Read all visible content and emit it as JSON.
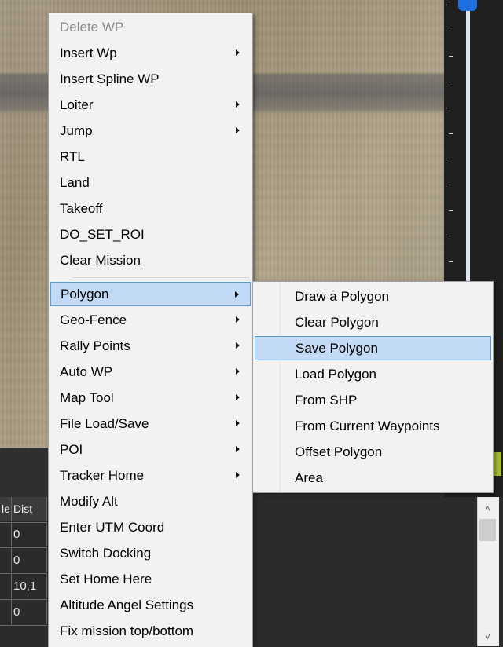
{
  "context_menu": {
    "items": [
      {
        "label": "Delete WP",
        "submenu": false,
        "disabled": true,
        "highlight": false
      },
      {
        "label": "Insert Wp",
        "submenu": true,
        "disabled": false,
        "highlight": false
      },
      {
        "label": "Insert Spline WP",
        "submenu": false,
        "disabled": false,
        "highlight": false
      },
      {
        "label": "Loiter",
        "submenu": true,
        "disabled": false,
        "highlight": false
      },
      {
        "label": "Jump",
        "submenu": true,
        "disabled": false,
        "highlight": false
      },
      {
        "label": "RTL",
        "submenu": false,
        "disabled": false,
        "highlight": false
      },
      {
        "label": "Land",
        "submenu": false,
        "disabled": false,
        "highlight": false
      },
      {
        "label": "Takeoff",
        "submenu": false,
        "disabled": false,
        "highlight": false
      },
      {
        "label": "DO_SET_ROI",
        "submenu": false,
        "disabled": false,
        "highlight": false
      },
      {
        "label": "Clear Mission",
        "submenu": false,
        "disabled": false,
        "highlight": false
      },
      {
        "label": "Polygon",
        "submenu": true,
        "disabled": false,
        "highlight": true
      },
      {
        "label": "Geo-Fence",
        "submenu": true,
        "disabled": false,
        "highlight": false
      },
      {
        "label": "Rally Points",
        "submenu": true,
        "disabled": false,
        "highlight": false
      },
      {
        "label": "Auto WP",
        "submenu": true,
        "disabled": false,
        "highlight": false
      },
      {
        "label": "Map Tool",
        "submenu": true,
        "disabled": false,
        "highlight": false
      },
      {
        "label": "File Load/Save",
        "submenu": true,
        "disabled": false,
        "highlight": false
      },
      {
        "label": "POI",
        "submenu": true,
        "disabled": false,
        "highlight": false
      },
      {
        "label": "Tracker Home",
        "submenu": true,
        "disabled": false,
        "highlight": false
      },
      {
        "label": "Modify Alt",
        "submenu": false,
        "disabled": false,
        "highlight": false
      },
      {
        "label": "Enter UTM Coord",
        "submenu": false,
        "disabled": false,
        "highlight": false
      },
      {
        "label": "Switch Docking",
        "submenu": false,
        "disabled": false,
        "highlight": false
      },
      {
        "label": "Set Home Here",
        "submenu": false,
        "disabled": false,
        "highlight": false
      },
      {
        "label": "Altitude Angel Settings",
        "submenu": false,
        "disabled": false,
        "highlight": false
      },
      {
        "label": "Fix mission top/bottom",
        "submenu": false,
        "disabled": false,
        "highlight": false
      }
    ]
  },
  "polygon_submenu": {
    "items": [
      {
        "label": "Draw a Polygon",
        "highlight": false
      },
      {
        "label": "Clear Polygon",
        "highlight": false
      },
      {
        "label": "Save Polygon",
        "highlight": true
      },
      {
        "label": "Load Polygon",
        "highlight": false
      },
      {
        "label": "From SHP",
        "highlight": false
      },
      {
        "label": "From Current Waypoints",
        "highlight": false
      },
      {
        "label": "Offset Polygon",
        "highlight": false
      },
      {
        "label": "Area",
        "highlight": false
      }
    ]
  },
  "mission_grid": {
    "headers": [
      "le",
      "Dist"
    ],
    "rows": [
      [
        "",
        "0"
      ],
      [
        "",
        "0"
      ],
      [
        "",
        "10,1"
      ],
      [
        "",
        "0"
      ]
    ]
  },
  "scale": {
    "tick_label": "-",
    "tick_count": 11
  },
  "colors": {
    "highlight_fill": "#c2daf5",
    "highlight_border": "#5a9ad8",
    "scale_knob": "#1f6fe0",
    "menu_bg": "#f2f2f2",
    "disabled_text": "#8a8a8a"
  },
  "scrollbar": {
    "up_icon": "chevron-up-icon",
    "down_icon": "chevron-down-icon"
  }
}
